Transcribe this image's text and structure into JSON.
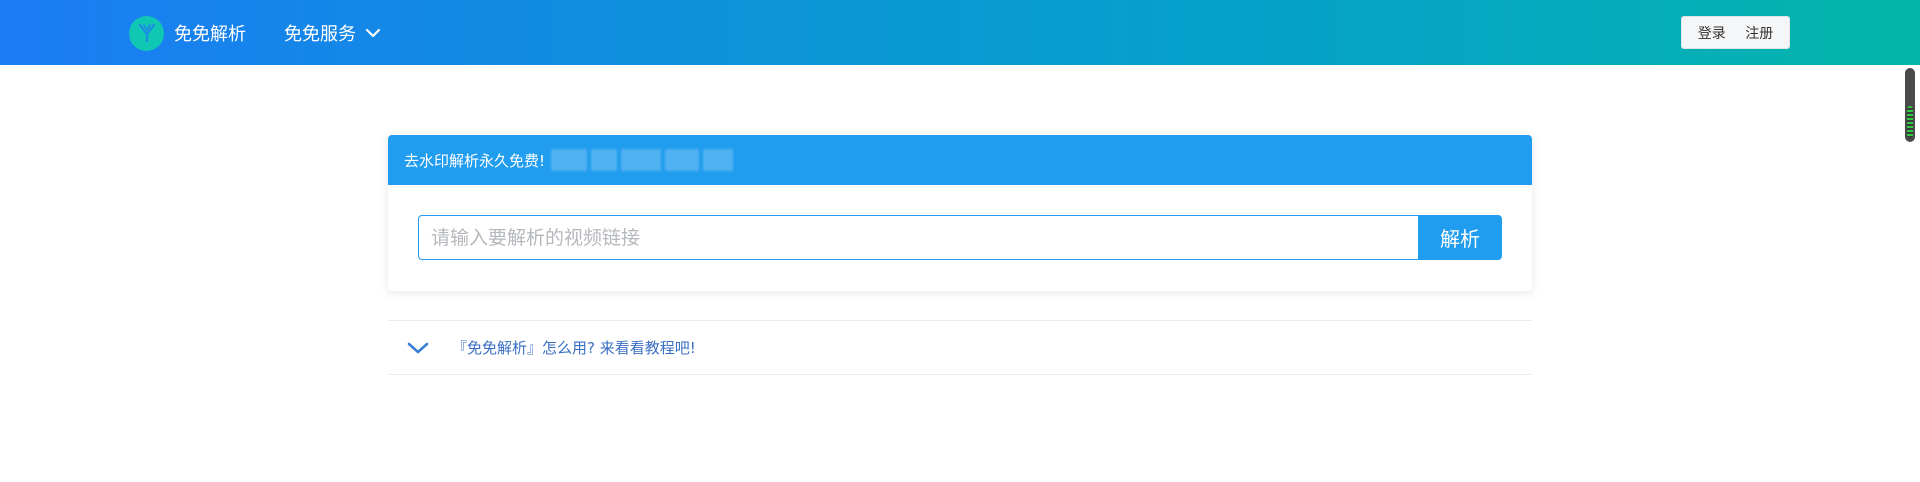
{
  "header": {
    "brand_name": "免免解析",
    "services_label": "免免服务",
    "login_label": "登录",
    "register_label": "注册"
  },
  "card": {
    "banner_text": "去水印解析永久免费!",
    "input_placeholder": "请输入要解析的视频链接",
    "parse_button_label": "解析"
  },
  "tutorial": {
    "text": "『免免解析』怎么用? 来看看教程吧!"
  },
  "icons": {
    "logo": "y-logo-icon",
    "services_chevron": "chevron-down-icon",
    "tutorial_chevron": "chevron-down-icon"
  },
  "colors": {
    "accent": "#219def",
    "header_start": "#1b7cf5",
    "header_end": "#03b6a9",
    "tutorial_text": "#3a6fc4"
  }
}
